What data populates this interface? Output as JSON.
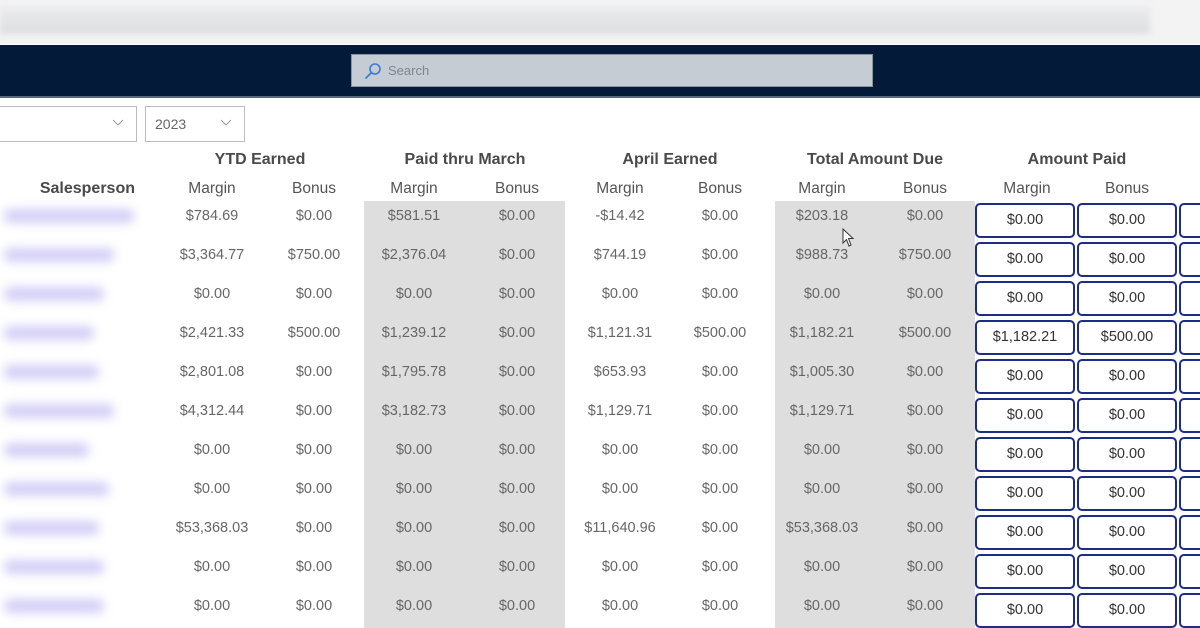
{
  "header": {
    "search_placeholder": "Search",
    "search_icon": "search-icon"
  },
  "filters": {
    "salesperson_filter_value": "",
    "year_filter_value": "2023"
  },
  "table": {
    "salesperson_header": "Salesperson",
    "groups": [
      {
        "label": "YTD Earned",
        "sub": [
          "Margin",
          "Bonus"
        ]
      },
      {
        "label": "Paid thru March",
        "sub": [
          "Margin",
          "Bonus"
        ]
      },
      {
        "label": "April Earned",
        "sub": [
          "Margin",
          "Bonus"
        ]
      },
      {
        "label": "Total Amount Due",
        "sub": [
          "Margin",
          "Bonus"
        ]
      },
      {
        "label": "Amount Paid",
        "sub": [
          "Margin",
          "Bonus"
        ]
      }
    ],
    "rows": [
      {
        "ytd_margin": "$784.69",
        "ytd_bonus": "$0.00",
        "paid_margin": "$581.51",
        "paid_bonus": "$0.00",
        "april_margin": "-$14.42",
        "april_bonus": "$0.00",
        "due_margin": "$203.18",
        "due_bonus": "$0.00",
        "amt_margin": "$0.00",
        "amt_bonus": "$0.00"
      },
      {
        "ytd_margin": "$3,364.77",
        "ytd_bonus": "$750.00",
        "paid_margin": "$2,376.04",
        "paid_bonus": "$0.00",
        "april_margin": "$744.19",
        "april_bonus": "$0.00",
        "due_margin": "$988.73",
        "due_bonus": "$750.00",
        "amt_margin": "$0.00",
        "amt_bonus": "$0.00"
      },
      {
        "ytd_margin": "$0.00",
        "ytd_bonus": "$0.00",
        "paid_margin": "$0.00",
        "paid_bonus": "$0.00",
        "april_margin": "$0.00",
        "april_bonus": "$0.00",
        "due_margin": "$0.00",
        "due_bonus": "$0.00",
        "amt_margin": "$0.00",
        "amt_bonus": "$0.00"
      },
      {
        "ytd_margin": "$2,421.33",
        "ytd_bonus": "$500.00",
        "paid_margin": "$1,239.12",
        "paid_bonus": "$0.00",
        "april_margin": "$1,121.31",
        "april_bonus": "$500.00",
        "due_margin": "$1,182.21",
        "due_bonus": "$500.00",
        "amt_margin": "$1,182.21",
        "amt_bonus": "$500.00"
      },
      {
        "ytd_margin": "$2,801.08",
        "ytd_bonus": "$0.00",
        "paid_margin": "$1,795.78",
        "paid_bonus": "$0.00",
        "april_margin": "$653.93",
        "april_bonus": "$0.00",
        "due_margin": "$1,005.30",
        "due_bonus": "$0.00",
        "amt_margin": "$0.00",
        "amt_bonus": "$0.00"
      },
      {
        "ytd_margin": "$4,312.44",
        "ytd_bonus": "$0.00",
        "paid_margin": "$3,182.73",
        "paid_bonus": "$0.00",
        "april_margin": "$1,129.71",
        "april_bonus": "$0.00",
        "due_margin": "$1,129.71",
        "due_bonus": "$0.00",
        "amt_margin": "$0.00",
        "amt_bonus": "$0.00"
      },
      {
        "ytd_margin": "$0.00",
        "ytd_bonus": "$0.00",
        "paid_margin": "$0.00",
        "paid_bonus": "$0.00",
        "april_margin": "$0.00",
        "april_bonus": "$0.00",
        "due_margin": "$0.00",
        "due_bonus": "$0.00",
        "amt_margin": "$0.00",
        "amt_bonus": "$0.00"
      },
      {
        "ytd_margin": "$0.00",
        "ytd_bonus": "$0.00",
        "paid_margin": "$0.00",
        "paid_bonus": "$0.00",
        "april_margin": "$0.00",
        "april_bonus": "$0.00",
        "due_margin": "$0.00",
        "due_bonus": "$0.00",
        "amt_margin": "$0.00",
        "amt_bonus": "$0.00"
      },
      {
        "ytd_margin": "$53,368.03",
        "ytd_bonus": "$0.00",
        "paid_margin": "$0.00",
        "paid_bonus": "$0.00",
        "april_margin": "$11,640.96",
        "april_bonus": "$0.00",
        "due_margin": "$53,368.03",
        "due_bonus": "$0.00",
        "amt_margin": "$0.00",
        "amt_bonus": "$0.00"
      },
      {
        "ytd_margin": "$0.00",
        "ytd_bonus": "$0.00",
        "paid_margin": "$0.00",
        "paid_bonus": "$0.00",
        "april_margin": "$0.00",
        "april_bonus": "$0.00",
        "due_margin": "$0.00",
        "due_bonus": "$0.00",
        "amt_margin": "$0.00",
        "amt_bonus": "$0.00"
      },
      {
        "ytd_margin": "$0.00",
        "ytd_bonus": "$0.00",
        "paid_margin": "$0.00",
        "paid_bonus": "$0.00",
        "april_margin": "$0.00",
        "april_bonus": "$0.00",
        "due_margin": "$0.00",
        "due_bonus": "$0.00",
        "amt_margin": "$0.00",
        "amt_bonus": "$0.00"
      }
    ]
  },
  "colors": {
    "header_bg": "#031a38",
    "input_border": "#1d2d85",
    "shaded_column_bg": "#dedede"
  }
}
